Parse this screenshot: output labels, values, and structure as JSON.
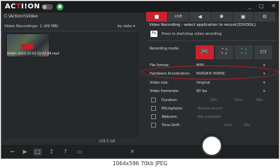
{
  "app": {
    "logo_main": "AC",
    "logo_o": "T",
    "logo_end": "I!ON",
    "window_buttons": [
      "_",
      "▢",
      "✕"
    ]
  },
  "path": "C:\\Action!\\Video",
  "recordings": {
    "header": "Video Recordings: 1 (69 MB)",
    "sort": "by date",
    "clip_caption": "Action 2023-12-03 12-47-48.mp4"
  },
  "storage": "106.5 GB",
  "section": {
    "title": "Video Recording - select application to record [DX/OGL]",
    "fx_label": "Fx",
    "hint": "Press to start/stop video recording"
  },
  "tabs": [
    {
      "icon": "■"
    },
    {
      "icon": "LIVE"
    },
    {
      "icon": "◀"
    },
    {
      "icon": "✺"
    },
    {
      "icon": "▣"
    },
    {
      "icon": "⚙"
    }
  ],
  "settings": {
    "recording_mode_label": "Recording mode:",
    "file_format_label": "File format:",
    "file_format": "MP4",
    "hw_label": "Hardware Acceleration:",
    "hw_value": "NVIDIA® NVENC",
    "video_size_label": "Video size:",
    "video_size": "Original",
    "framerate_label": "Video framerate:",
    "framerate": "60 fps",
    "duration_label": "Duration:",
    "duration_h": "00h",
    "duration_m": "00m",
    "duration_s": "00s",
    "microphone_label": "Microphone:",
    "microphone": "Always record",
    "webcam_label": "Webcam:",
    "webcam": "Not available",
    "timeshift_label": "Time-Shift:",
    "timeshift_m": "01m",
    "timeshift_s": "00s"
  },
  "caption": "1064x596  70kb  JPEG"
}
